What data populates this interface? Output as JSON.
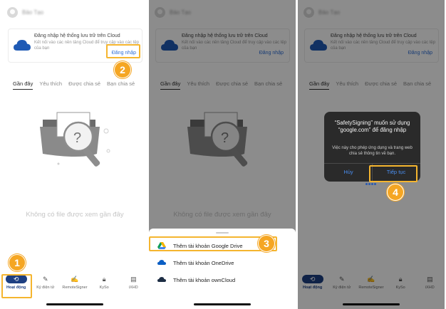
{
  "colors": {
    "accent": "#1d3f82",
    "link": "#2f6fd6",
    "callout": "#f5b52f",
    "step": "#f5a623"
  },
  "user": {
    "name": "Bảo Tạo"
  },
  "cloud_card": {
    "title": "Đăng nhập hệ thống lưu trữ trên Cloud",
    "description": "Kết nối vào các nền tảng Cloud để truy cập vào các tệp của bạn",
    "login_label": "Đăng nhập",
    "icon": "cloud-icon"
  },
  "tabs": [
    {
      "label": "Gần đây",
      "active": true
    },
    {
      "label": "Yêu thích",
      "active": false
    },
    {
      "label": "Được chia sẻ",
      "active": false
    },
    {
      "label": "Bạn chia sẻ",
      "active": false
    }
  ],
  "empty_state": {
    "text": "Không có file được xem gần đây",
    "icon": "folder-search-icon"
  },
  "bottom_nav": [
    {
      "label": "Hoạt động",
      "icon": "history-icon",
      "active": true
    },
    {
      "label": "Ký điện tử",
      "icon": "pen-icon",
      "active": false
    },
    {
      "label": "RemoteSigner",
      "icon": "signature-icon",
      "active": false
    },
    {
      "label": "KySo",
      "icon": "lock-icon",
      "active": false
    },
    {
      "label": "iXHD",
      "icon": "document-icon",
      "active": false
    }
  ],
  "sheet": {
    "items": [
      {
        "label": "Thêm tài khoản Google Drive",
        "icon": "google-drive-icon"
      },
      {
        "label": "Thêm tài khoản OneDrive",
        "icon": "onedrive-icon"
      },
      {
        "label": "Thêm tài khoản ownCloud",
        "icon": "owncloud-icon"
      }
    ]
  },
  "alert": {
    "title": "“SafetySigning” muốn sử dụng “google.com” để đăng nhập",
    "message": "Việc này cho phép ứng dụng và trang web chia sẻ thông tin về bạn.",
    "cancel_label": "Hủy",
    "continue_label": "Tiếp tục"
  },
  "steps": [
    "1",
    "2",
    "3",
    "4"
  ]
}
